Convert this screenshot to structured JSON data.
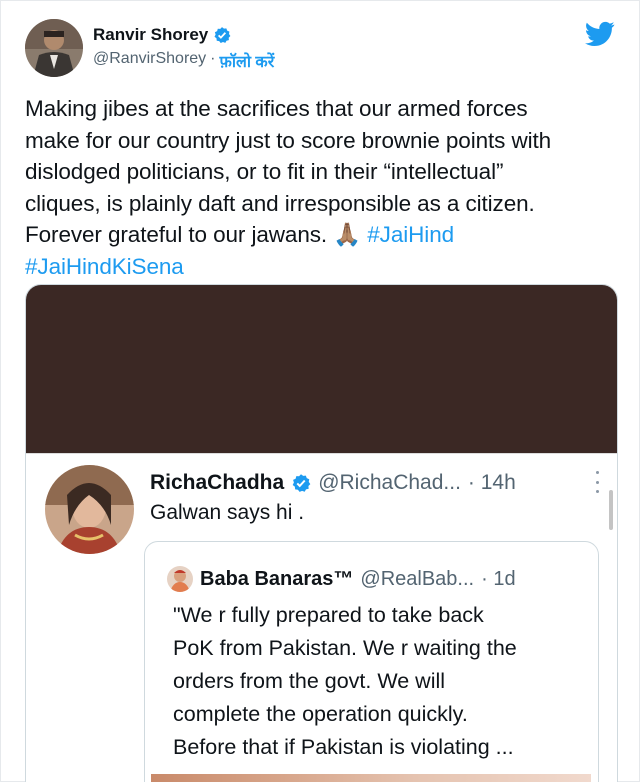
{
  "tweet": {
    "author_name": "Ranvir Shorey",
    "handle": "@RanvirShorey",
    "separator": "·",
    "follow_label": "फ़ॉलो करें",
    "text_lines": [
      "Making jibes at the sacrifices that our armed forces",
      "make for our country just to score brownie points with",
      "dislodged politicians, or to fit in their “intellectual”",
      "cliques, is plainly daft and irresponsible as a citizen.",
      "Forever grateful to our jawans. 🙏🏽 "
    ],
    "hashtag1": "#JaiHind",
    "hashtag2": "#JaiHindKiSena"
  },
  "quoted": {
    "name": "RichaChadha",
    "handle": "@RichaChad...",
    "time": "· 14h",
    "text": "Galwan says hi ."
  },
  "inner": {
    "name": "Baba Banaras™",
    "handle": "@RealBab...",
    "time": "· 1d",
    "lines": [
      "\"We r fully prepared to take back",
      "PoK from Pakistan. We r waiting the",
      "orders from the govt. We will",
      "complete the operation quickly.",
      "Before that if Pakistan is violating ..."
    ]
  },
  "colors": {
    "accent": "#1d9bf0",
    "media_dark": "#3b2824"
  },
  "icons": {
    "logo": "twitter-bird-icon",
    "verified": "verified-badge-icon",
    "more": "more-options-icon"
  }
}
